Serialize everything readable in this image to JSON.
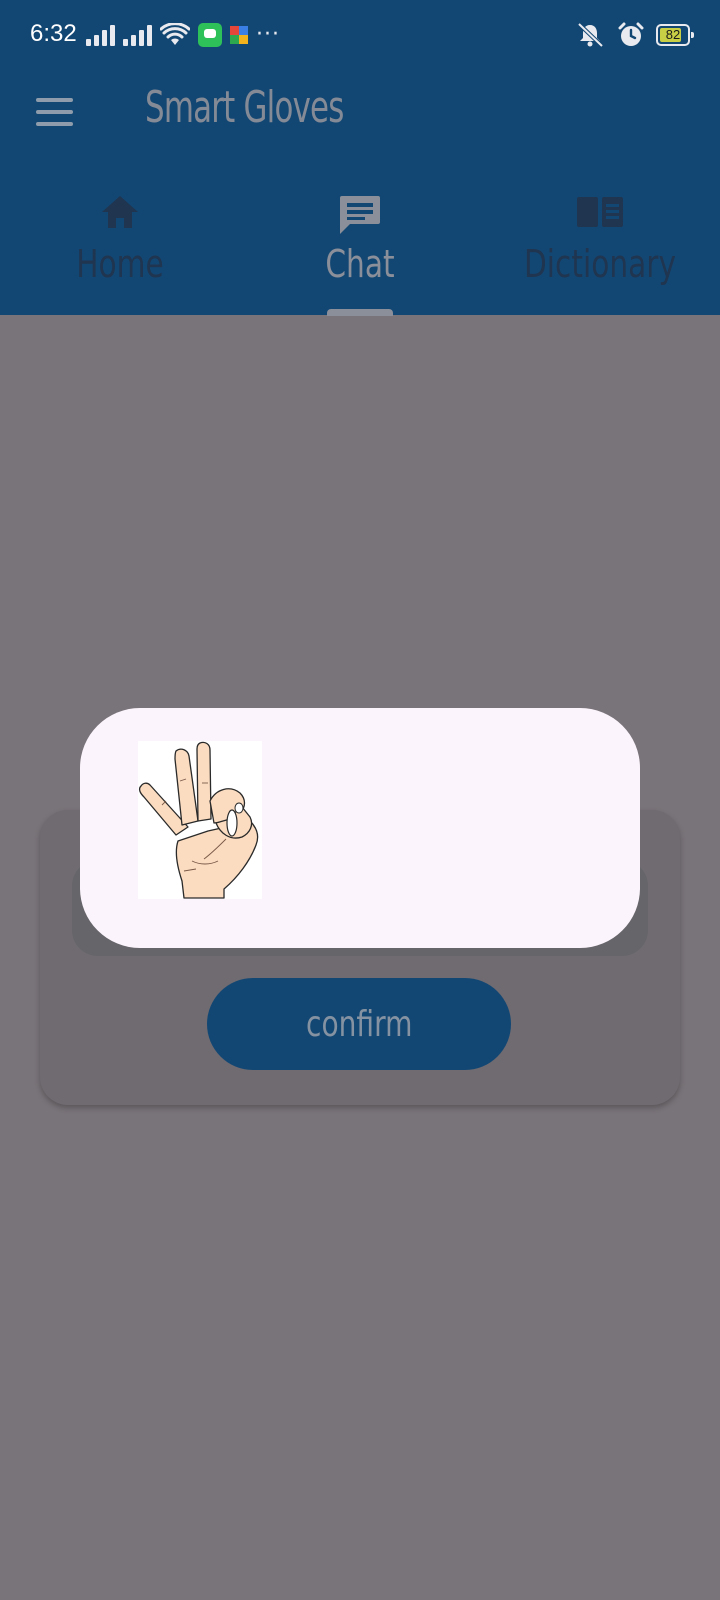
{
  "status_bar": {
    "time": "6:32",
    "battery_level": "82",
    "battery_fraction": 0.82,
    "icons": [
      "signal-icon",
      "signal-icon",
      "wifi-icon",
      "message-app-icon",
      "puzzle-app-icon",
      "more-dots-icon",
      "vibrate-icon",
      "alarm-icon",
      "battery-icon"
    ]
  },
  "app_bar": {
    "title": "Smart Gloves",
    "menu_icon": "menu-icon"
  },
  "tabs": [
    {
      "label": "Home",
      "icon": "home-icon",
      "active": false
    },
    {
      "label": "Chat",
      "icon": "chat-icon",
      "active": true
    },
    {
      "label": "Dictionary",
      "icon": "book-icon",
      "active": false
    }
  ],
  "card": {
    "confirm_label": "confirm"
  },
  "dialog": {
    "image_icon": "ok-hand-sign-image"
  },
  "colors": {
    "primary": "#134773",
    "scrim_background": "#797479",
    "dialog_background": "#fcf4fc"
  }
}
